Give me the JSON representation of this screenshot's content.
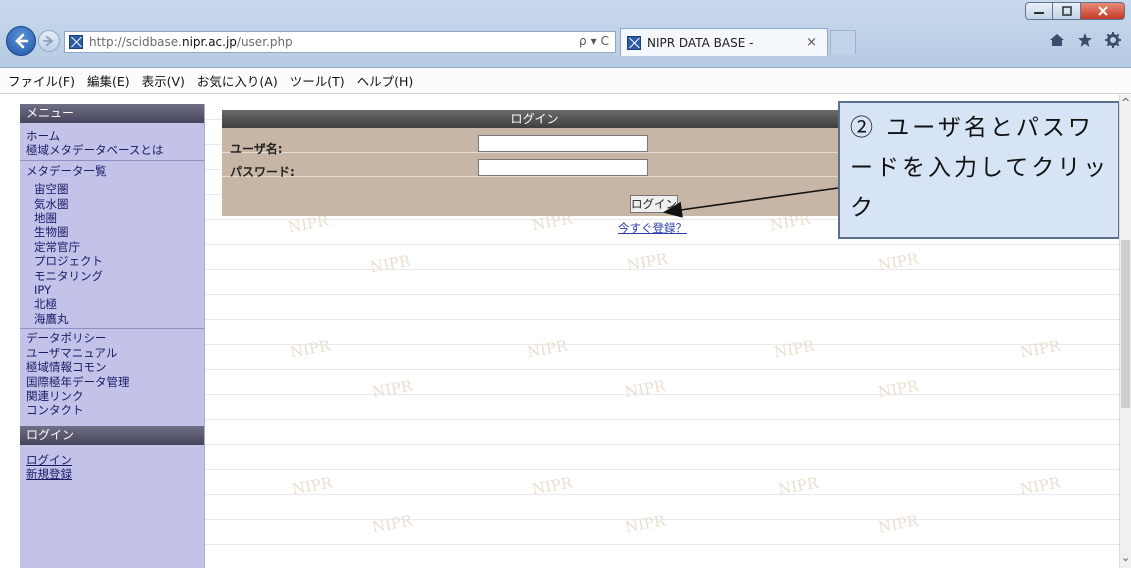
{
  "browser": {
    "url_prefix": "http://scidbase.",
    "url_domain": "nipr.ac.jp",
    "url_path": "/user.php",
    "search_glyph": "ρ",
    "dropdown_glyph": "▾",
    "refresh_glyph": "C",
    "tab_title": "NIPR DATA BASE -",
    "tab_close": "×"
  },
  "menubar": {
    "items": [
      "ファイル(F)",
      "編集(E)",
      "表示(V)",
      "お気に入り(A)",
      "ツール(T)",
      "ヘルプ(H)"
    ]
  },
  "sidebar": {
    "menu_header": "メニュー",
    "home": "ホーム",
    "about": "極域メタデータベースとは",
    "metadata_list": "メタデータ一覧",
    "categories": [
      "宙空圏",
      "気水圏",
      "地圏",
      "生物圏",
      "定常官庁",
      "プロジェクト",
      "モニタリング",
      "IPY",
      "北極",
      "海鷹丸"
    ],
    "policy": "データポリシー",
    "manual": "ユーザマニュアル",
    "commons": "極域情報コモン",
    "ipy_data": "国際極年データ管理",
    "links": "関連リンク",
    "contact": "コンタクト",
    "login_header": "ログイン",
    "login_link": "ログイン",
    "signup_link": "新規登録"
  },
  "login": {
    "header": "ログイン",
    "username_label": "ユーザ名:",
    "password_label": "パスワード:",
    "username_value": "",
    "password_value": "",
    "button": "ログイン",
    "register_link": "今すぐ登録？"
  },
  "watermark": "NIPR",
  "callout": {
    "text": "② ユーザ名とパスワードを入力してクリック"
  },
  "scroll": {
    "up": "^",
    "down": "⌄"
  }
}
